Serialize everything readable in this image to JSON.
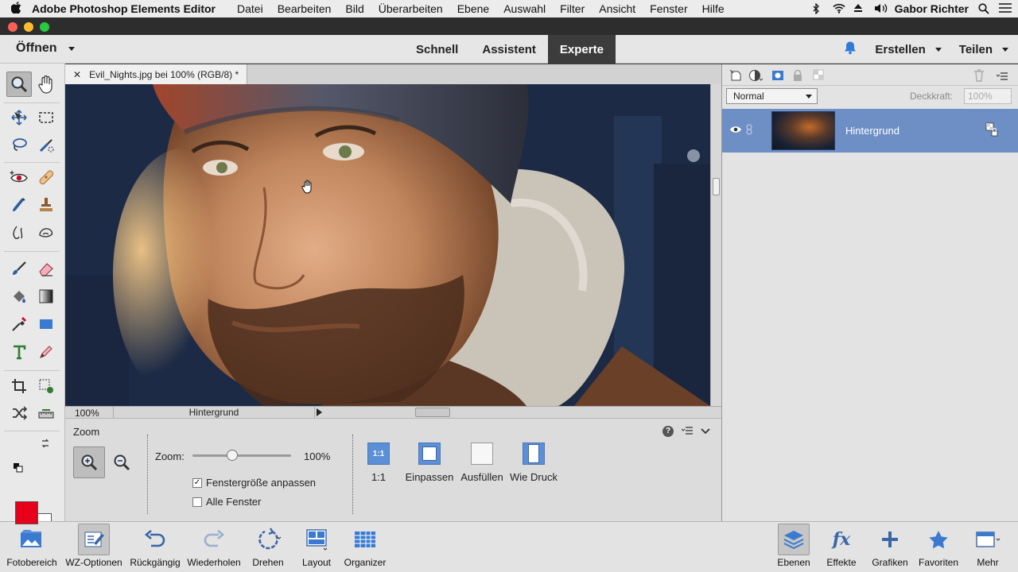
{
  "menubar": {
    "app_name": "Adobe Photoshop Elements Editor",
    "menus": [
      "Datei",
      "Bearbeiten",
      "Bild",
      "Überarbeiten",
      "Ebene",
      "Auswahl",
      "Filter",
      "Ansicht",
      "Fenster",
      "Hilfe"
    ],
    "user": "Gabor Richter"
  },
  "modebar": {
    "open_label": "Öffnen",
    "modes": [
      "Schnell",
      "Assistent",
      "Experte"
    ],
    "active_mode": "Experte",
    "create_label": "Erstellen",
    "share_label": "Teilen"
  },
  "colors": {
    "foreground": "#e8001a",
    "background": "#ffffff",
    "accent": "#6d8fc5",
    "active_mode_bg": "#3c3c3c"
  },
  "document": {
    "tab_title": "Evil_Nights.jpg bei 100% (RGB/8) *",
    "status_zoom": "100%",
    "status_layer": "Hintergrund"
  },
  "tool_options": {
    "title": "Zoom",
    "zoom_label": "Zoom:",
    "zoom_value": "100%",
    "zoom_level_percent": 100,
    "resize_windows_label": "Fenstergröße anpassen",
    "resize_windows_checked": true,
    "all_windows_label": "Alle Fenster",
    "all_windows_checked": false,
    "buttons": {
      "one_to_one_icon": "1:1",
      "one_to_one": "1:1",
      "fit": "Einpassen",
      "fill": "Ausfüllen",
      "print": "Wie Druck"
    }
  },
  "layers_panel": {
    "blend_mode": "Normal",
    "opacity_label": "Deckkraft:",
    "opacity_value": "100%",
    "layer_name": "Hintergrund"
  },
  "taskbar": {
    "left": [
      "Fotobereich",
      "WZ-Optionen",
      "Rückgängig",
      "Wiederholen",
      "Drehen",
      "Layout",
      "Organizer"
    ],
    "right": [
      "Ebenen",
      "Effekte",
      "Grafiken",
      "Favoriten",
      "Mehr"
    ]
  }
}
